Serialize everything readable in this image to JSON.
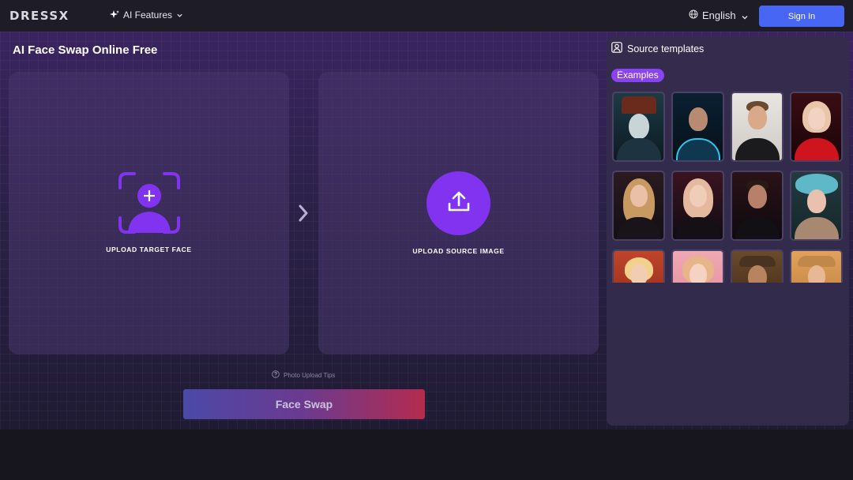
{
  "header": {
    "logo": "DRESSX",
    "ai_features": "AI Features",
    "language": "English",
    "sign_in": "Sign In"
  },
  "main": {
    "title": "AI Face Swap Online Free",
    "upload_target": "UPLOAD TARGET FACE",
    "upload_source": "UPLOAD SOURCE IMAGE",
    "tips": "Photo Upload Tips",
    "swap_button": "Face Swap"
  },
  "sidebar": {
    "title": "Source templates",
    "tab": "Examples"
  },
  "colors": {
    "accent_purple": "#8233f0",
    "sign_in_blue": "#4766f4",
    "examples_tag": "#8a43f0"
  },
  "icons": {
    "ai_features": "sparkle-icon",
    "ai_chevron": "chevron-down-icon",
    "language": "globe-icon",
    "language_chevron": "chevron-down-icon",
    "target": "add-face-icon",
    "source": "upload-icon",
    "next": "chevron-right-icon",
    "tips": "help-circle-icon",
    "sidebar": "portrait-icon"
  }
}
